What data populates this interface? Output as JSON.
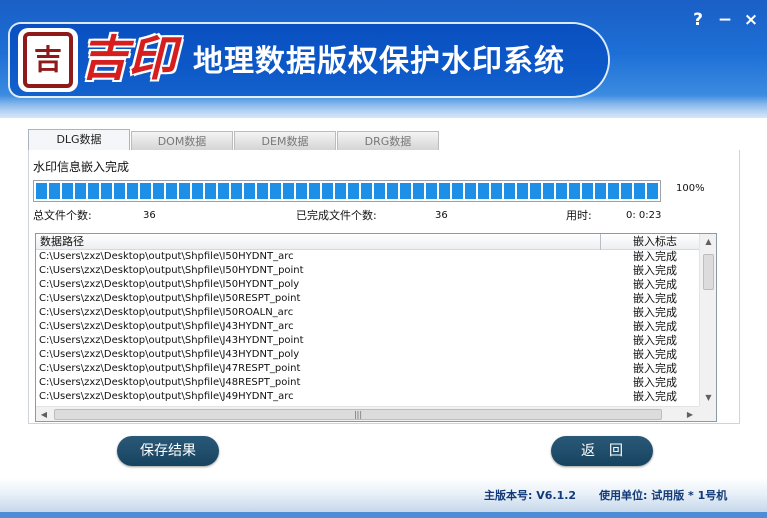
{
  "header": {
    "logo_seal_char": "吉",
    "brand": "吉印",
    "title": "地理数据版权保护水印系统",
    "help_label": "?",
    "minimize_label": "−",
    "close_label": "×"
  },
  "tabs": [
    {
      "label": "DLG数据",
      "active": true
    },
    {
      "label": "DOM数据",
      "active": false
    },
    {
      "label": "DEM数据",
      "active": false
    },
    {
      "label": "DRG数据",
      "active": false
    }
  ],
  "status": {
    "message": "水印信息嵌入完成",
    "progress_percent": 100,
    "progress_label": "100%",
    "total_files_label": "总文件个数:",
    "total_files_value": "36",
    "completed_files_label": "已完成文件个数:",
    "completed_files_value": "36",
    "elapsed_label": "用时:",
    "elapsed_value": "0: 0:23"
  },
  "table": {
    "columns": [
      "数据路径",
      "嵌入标志"
    ],
    "rows": [
      {
        "path": "C:\\Users\\zxz\\Desktop\\output\\Shpfile\\I50HYDNT_arc",
        "flag": "嵌入完成"
      },
      {
        "path": "C:\\Users\\zxz\\Desktop\\output\\Shpfile\\I50HYDNT_point",
        "flag": "嵌入完成"
      },
      {
        "path": "C:\\Users\\zxz\\Desktop\\output\\Shpfile\\I50HYDNT_poly",
        "flag": "嵌入完成"
      },
      {
        "path": "C:\\Users\\zxz\\Desktop\\output\\Shpfile\\I50RESPT_point",
        "flag": "嵌入完成"
      },
      {
        "path": "C:\\Users\\zxz\\Desktop\\output\\Shpfile\\I50ROALN_arc",
        "flag": "嵌入完成"
      },
      {
        "path": "C:\\Users\\zxz\\Desktop\\output\\Shpfile\\J43HYDNT_arc",
        "flag": "嵌入完成"
      },
      {
        "path": "C:\\Users\\zxz\\Desktop\\output\\Shpfile\\J43HYDNT_point",
        "flag": "嵌入完成"
      },
      {
        "path": "C:\\Users\\zxz\\Desktop\\output\\Shpfile\\J43HYDNT_poly",
        "flag": "嵌入完成"
      },
      {
        "path": "C:\\Users\\zxz\\Desktop\\output\\Shpfile\\J47RESPT_point",
        "flag": "嵌入完成"
      },
      {
        "path": "C:\\Users\\zxz\\Desktop\\output\\Shpfile\\J48RESPT_point",
        "flag": "嵌入完成"
      },
      {
        "path": "C:\\Users\\zxz\\Desktop\\output\\Shpfile\\J49HYDNT_arc",
        "flag": "嵌入完成"
      }
    ],
    "scroll_up_icon": "▲",
    "scroll_down_icon": "▼",
    "scroll_left_icon": "◀",
    "scroll_right_icon": "▶",
    "hscroll_grip": "|||"
  },
  "buttons": {
    "save_label": "保存结果",
    "back_label": "返回"
  },
  "footer": {
    "version": "主版本号: V6.1.2",
    "user": "使用单位: 试用版 * 1号机"
  },
  "colors": {
    "header_blue": "#1a5fc6",
    "progress_blue": "#1e8fe6",
    "button_dark": "#16435f",
    "brand_red": "#d61e1e",
    "footer_text": "#133a78"
  }
}
